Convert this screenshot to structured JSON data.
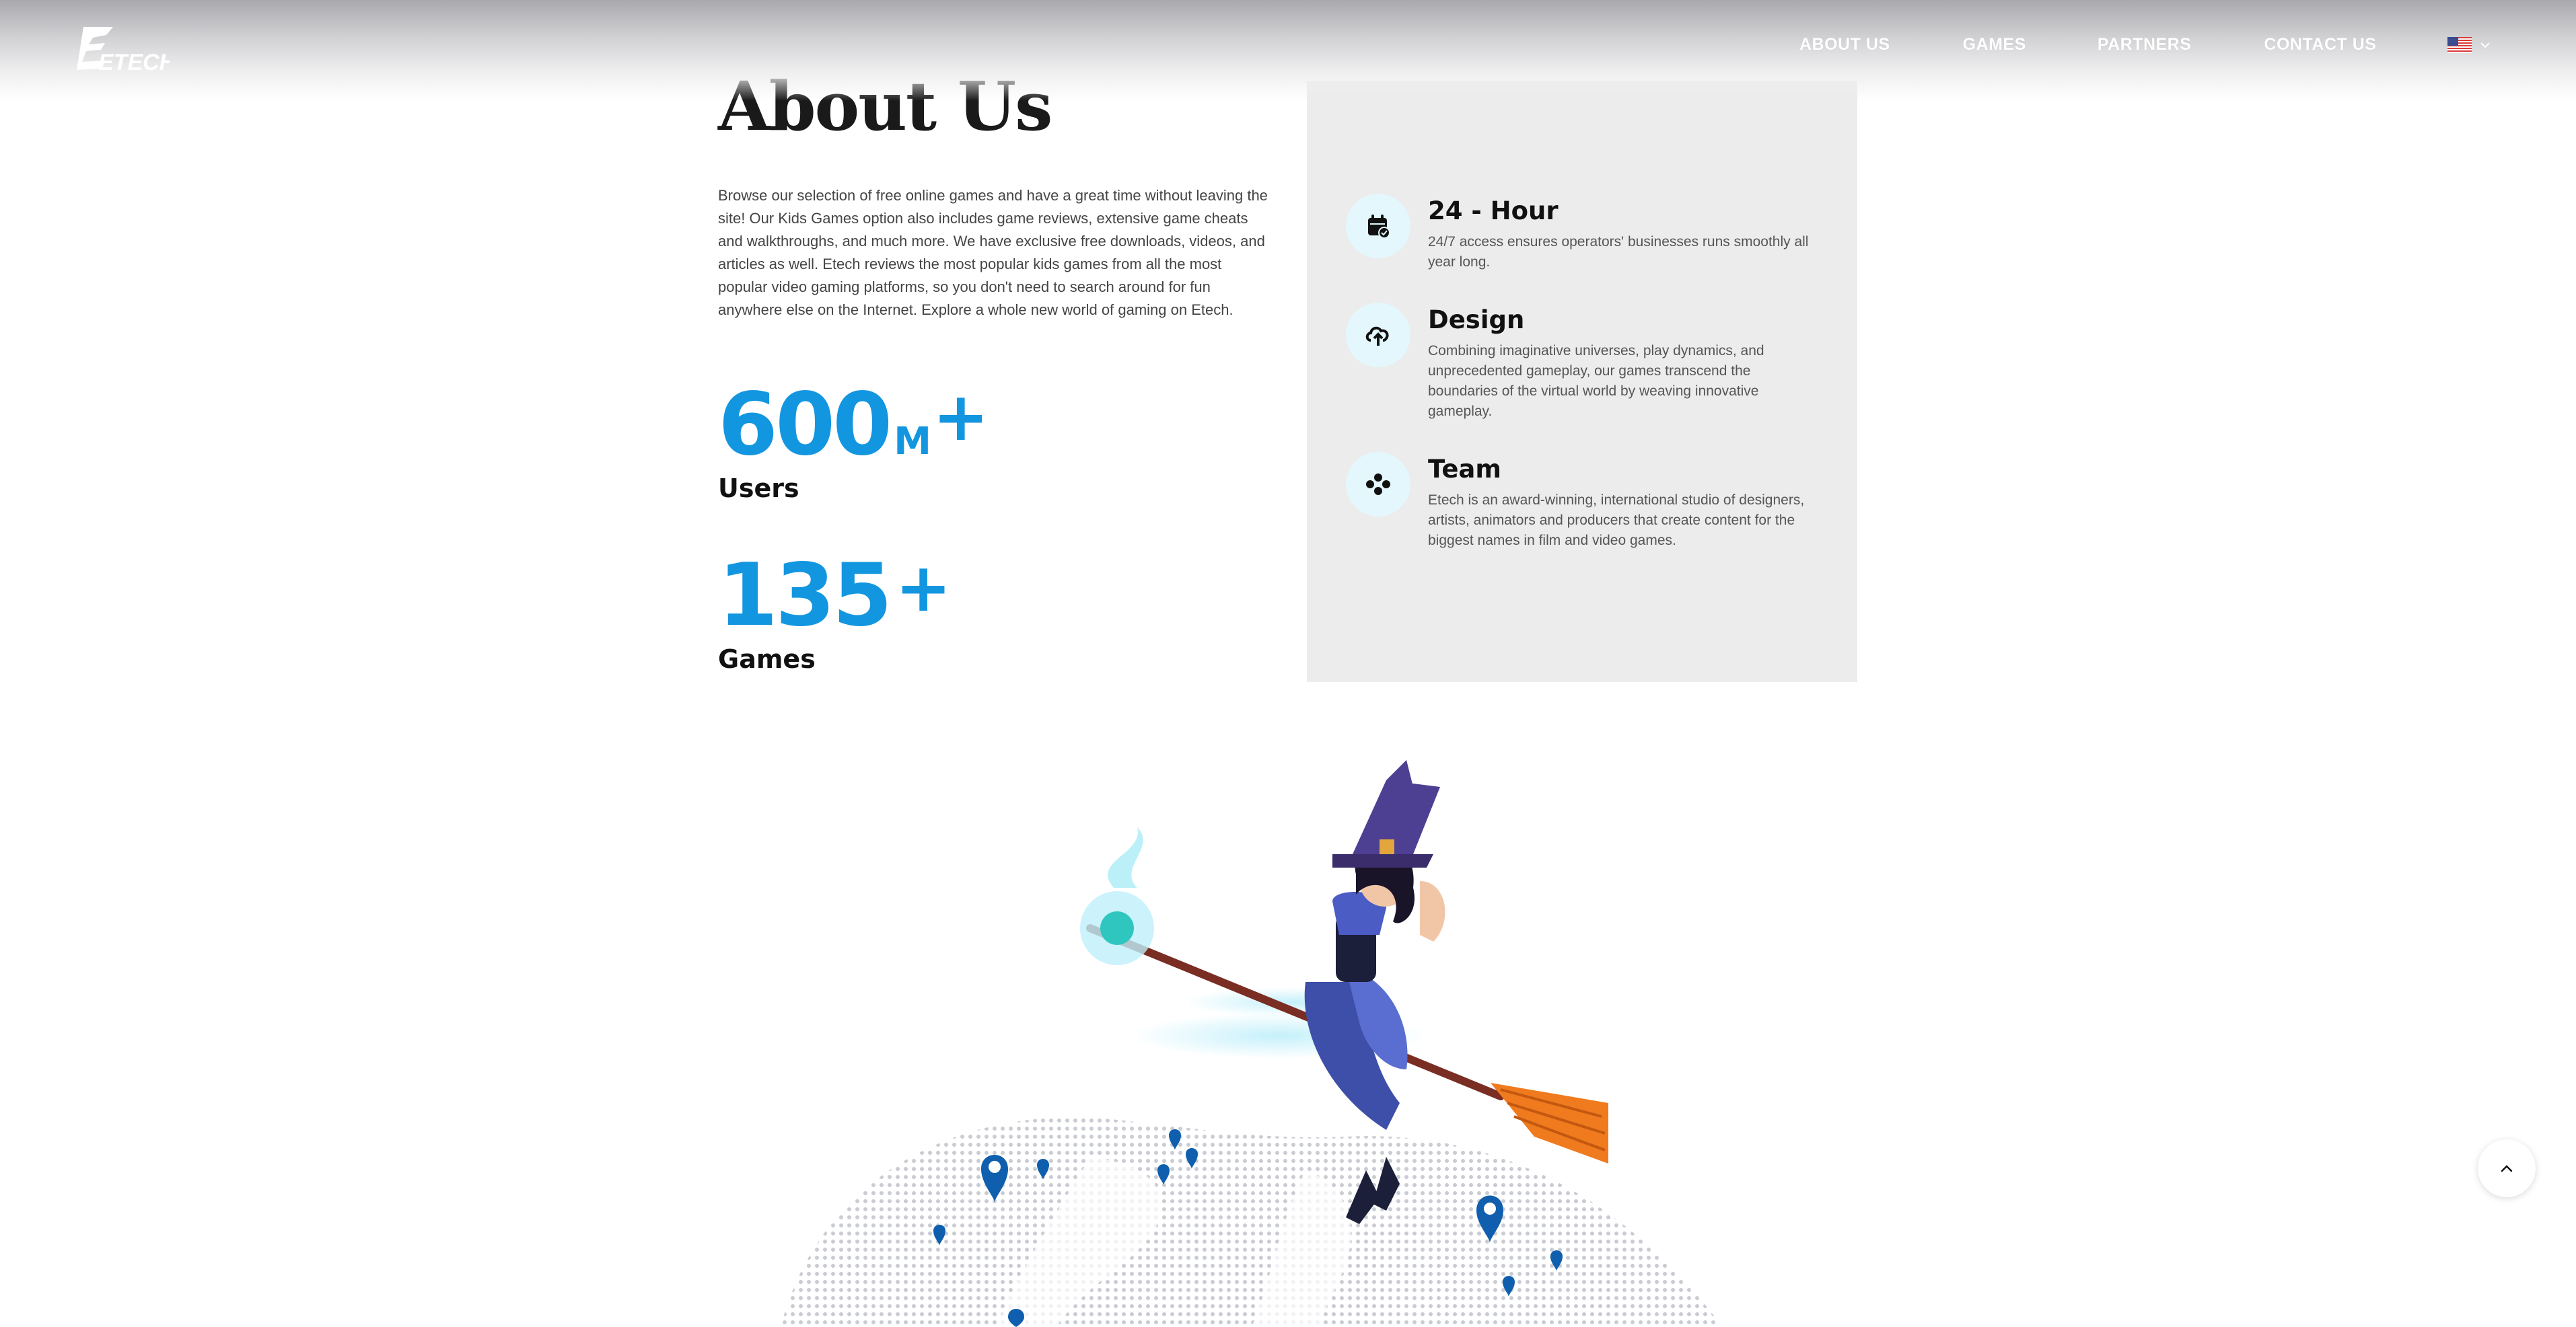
{
  "header": {
    "logo_text": "ETECH",
    "nav": [
      {
        "label": "ABOUT US"
      },
      {
        "label": "GAMES"
      },
      {
        "label": "PARTNERS"
      },
      {
        "label": "CONTACT US"
      }
    ],
    "language": {
      "flag": "us-flag-icon"
    }
  },
  "about": {
    "title": "About Us",
    "description": "Browse our selection of free online games and have a great time without leaving the site! Our Kids Games option also includes game reviews, extensive game cheats and walkthroughs, and much more. We have exclusive free downloads, videos, and articles as well. Etech reviews the most popular kids games from all the most popular video gaming platforms, so you don't need to search around for fun anywhere else on the Internet. Explore a whole new world of gaming on Etech.",
    "stats": [
      {
        "number": "600",
        "unit": "M",
        "plus": "+",
        "label": "Users"
      },
      {
        "number": "135",
        "unit": "",
        "plus": "+",
        "label": "Games"
      }
    ]
  },
  "features": [
    {
      "icon": "calendar-check-icon",
      "title": "24 - Hour",
      "text": "24/7 access ensures operators' businesses runs smoothly all year long."
    },
    {
      "icon": "cloud-upload-icon",
      "title": "Design",
      "text": "Combining imaginative universes, play dynamics, and unprecedented gameplay, our games transcend the boundaries of the virtual world by weaving innovative gameplay."
    },
    {
      "icon": "team-icon",
      "title": "Team",
      "text": "Etech is an award-winning, international studio of designers, artists, animators and producers that create content for the biggest names in film and video games."
    }
  ],
  "colors": {
    "accent": "#1396e0",
    "panel": "#ececec",
    "icon_bg": "#e3f7fc",
    "pin": "#0f5fae"
  },
  "scroll_top": {
    "icon": "chevron-up-icon"
  }
}
